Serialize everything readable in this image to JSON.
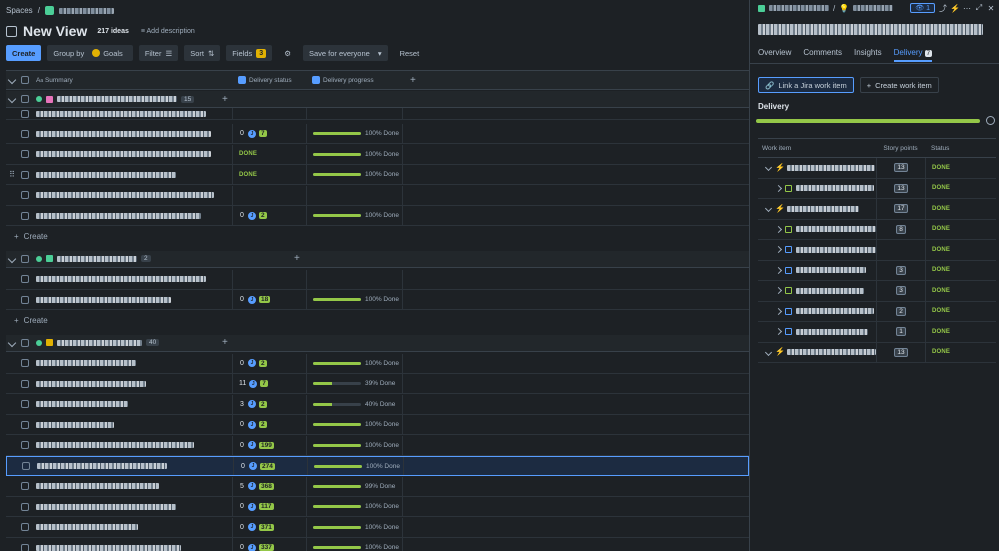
{
  "breadcrumb": {
    "spaces": "Spaces",
    "sep": "/"
  },
  "view": {
    "title": "New View",
    "ideas_count": "217 ideas",
    "add_description": "Add description"
  },
  "toolbar": {
    "create": "Create",
    "group_by": "Group by",
    "goals": "Goals",
    "filter": "Filter",
    "sort": "Sort",
    "fields": "Fields",
    "fields_count": "3",
    "save": "Save for everyone",
    "reset": "Reset"
  },
  "table": {
    "headers": {
      "summary": "Summary",
      "summary_prefix": "A",
      "delivery_status": "Delivery status",
      "delivery_progress": "Delivery progress"
    },
    "create_label": "Create",
    "groups": [
      {
        "count": "15",
        "rows": [
          {
            "status": "",
            "progress": null
          },
          {
            "status": "0,7",
            "progress": 100
          },
          {
            "status": "DONE",
            "progress": 100
          },
          {
            "status": "DONE",
            "progress": 100
          },
          {
            "status": "",
            "progress": null
          },
          {
            "status": "0,2",
            "progress": 100
          }
        ]
      },
      {
        "count": "2",
        "rows": [
          {
            "status": "",
            "progress": null
          },
          {
            "status": "0,18",
            "progress": 100
          }
        ]
      },
      {
        "count": "40",
        "rows": [
          {
            "status": "0,2",
            "progress": 100
          },
          {
            "status": "11,7",
            "progress": 39
          },
          {
            "status": "3,2",
            "progress": 40
          },
          {
            "status": "0,2",
            "progress": 100
          },
          {
            "status": "0,199",
            "progress": 100
          },
          {
            "status": "0,274",
            "progress": 100
          },
          {
            "status": "5,368",
            "progress": 99
          },
          {
            "status": "0,117",
            "progress": 100
          },
          {
            "status": "0,371",
            "progress": 100
          },
          {
            "status": "0,337",
            "progress": 100
          }
        ]
      }
    ],
    "done_suffix": "Done"
  },
  "panel": {
    "tabs": [
      "Overview",
      "Comments",
      "Insights",
      "Delivery"
    ],
    "delivery_count": "7",
    "watchers": "1",
    "link_jira": "Link a Jira work item",
    "create_work_item": "Create work item",
    "section": "Delivery",
    "headers": {
      "work_item": "Work item",
      "story_points": "Story points",
      "status": "Status"
    },
    "items": [
      {
        "type": "epic",
        "expanded": true,
        "points": "13",
        "status": "DONE",
        "indent": 0
      },
      {
        "type": "story",
        "expanded": false,
        "points": "13",
        "status": "DONE",
        "indent": 1
      },
      {
        "type": "epic",
        "expanded": true,
        "points": "17",
        "status": "DONE",
        "indent": 0
      },
      {
        "type": "story",
        "expanded": false,
        "points": "8",
        "status": "DONE",
        "indent": 1
      },
      {
        "type": "task",
        "expanded": false,
        "points": "",
        "status": "DONE",
        "indent": 1
      },
      {
        "type": "task",
        "expanded": false,
        "points": "3",
        "status": "DONE",
        "indent": 1
      },
      {
        "type": "story",
        "expanded": false,
        "points": "3",
        "status": "DONE",
        "indent": 1
      },
      {
        "type": "task",
        "expanded": false,
        "points": "2",
        "status": "DONE",
        "indent": 1
      },
      {
        "type": "task",
        "expanded": false,
        "points": "1",
        "status": "DONE",
        "indent": 1
      },
      {
        "type": "epic",
        "expanded": true,
        "points": "13",
        "status": "DONE",
        "indent": 0
      }
    ]
  }
}
